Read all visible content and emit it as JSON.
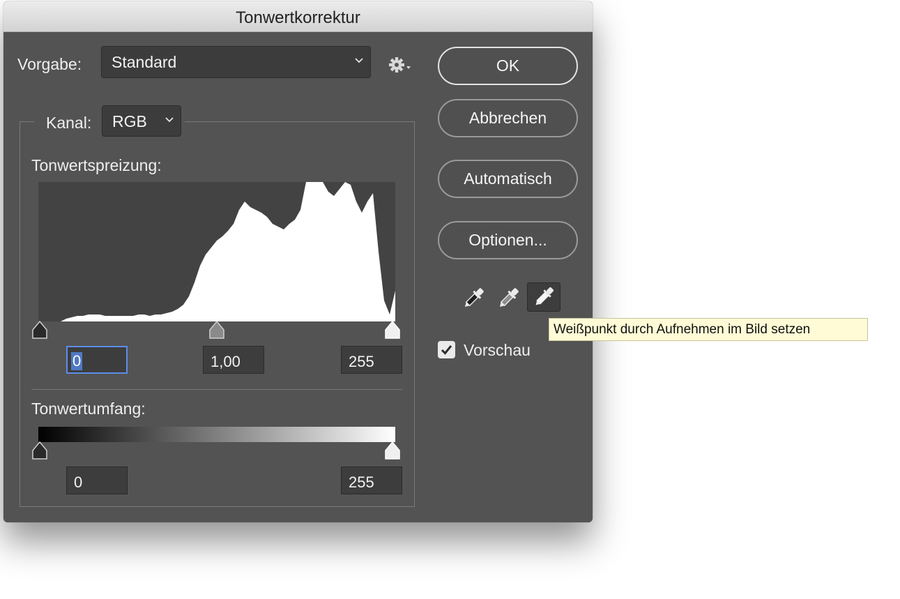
{
  "window": {
    "title": "Tonwertkorrektur"
  },
  "preset": {
    "label": "Vorgabe:",
    "value": "Standard"
  },
  "channel": {
    "label": "Kanal:",
    "value": "RGB"
  },
  "input_levels": {
    "label": "Tonwertspreizung:",
    "black": "0",
    "midtone": "1,00",
    "white": "255"
  },
  "output_levels": {
    "label": "Tonwertumfang:",
    "black": "0",
    "white": "255"
  },
  "buttons": {
    "ok": "OK",
    "cancel": "Abbrechen",
    "auto": "Automatisch",
    "options": "Optionen..."
  },
  "preview": {
    "label": "Vorschau",
    "checked": true
  },
  "tooltip": {
    "text": "Weißpunkt durch Aufnehmen im Bild setzen"
  },
  "icons": {
    "settings": "gear-icon",
    "black_point": "eyedropper-black-icon",
    "gray_point": "eyedropper-gray-icon",
    "white_point": "eyedropper-white-icon"
  },
  "colors": {
    "dialog_bg": "#535353",
    "field_bg": "#3d3d3d",
    "focus": "#5b8ee8",
    "histogram": "#ffffff",
    "histogram_bg": "#434343",
    "tooltip_bg": "#fefbd6"
  },
  "histogram": {
    "profile": [
      0,
      0,
      0,
      0,
      0,
      0.02,
      0.03,
      0.04,
      0.04,
      0.05,
      0.05,
      0.05,
      0.04,
      0.04,
      0.04,
      0.04,
      0.04,
      0.04,
      0.05,
      0.05,
      0.04,
      0.05,
      0.05,
      0.06,
      0.07,
      0.09,
      0.12,
      0.18,
      0.28,
      0.4,
      0.48,
      0.53,
      0.58,
      0.61,
      0.65,
      0.7,
      0.8,
      0.86,
      0.82,
      0.8,
      0.78,
      0.75,
      0.7,
      0.68,
      0.66,
      0.7,
      0.73,
      0.8,
      1,
      1,
      1,
      1,
      0.93,
      0.9,
      0.95,
      1,
      0.98,
      0.86,
      0.78,
      0.86,
      0.92,
      0.5,
      0.15,
      0.05,
      0.22
    ]
  }
}
